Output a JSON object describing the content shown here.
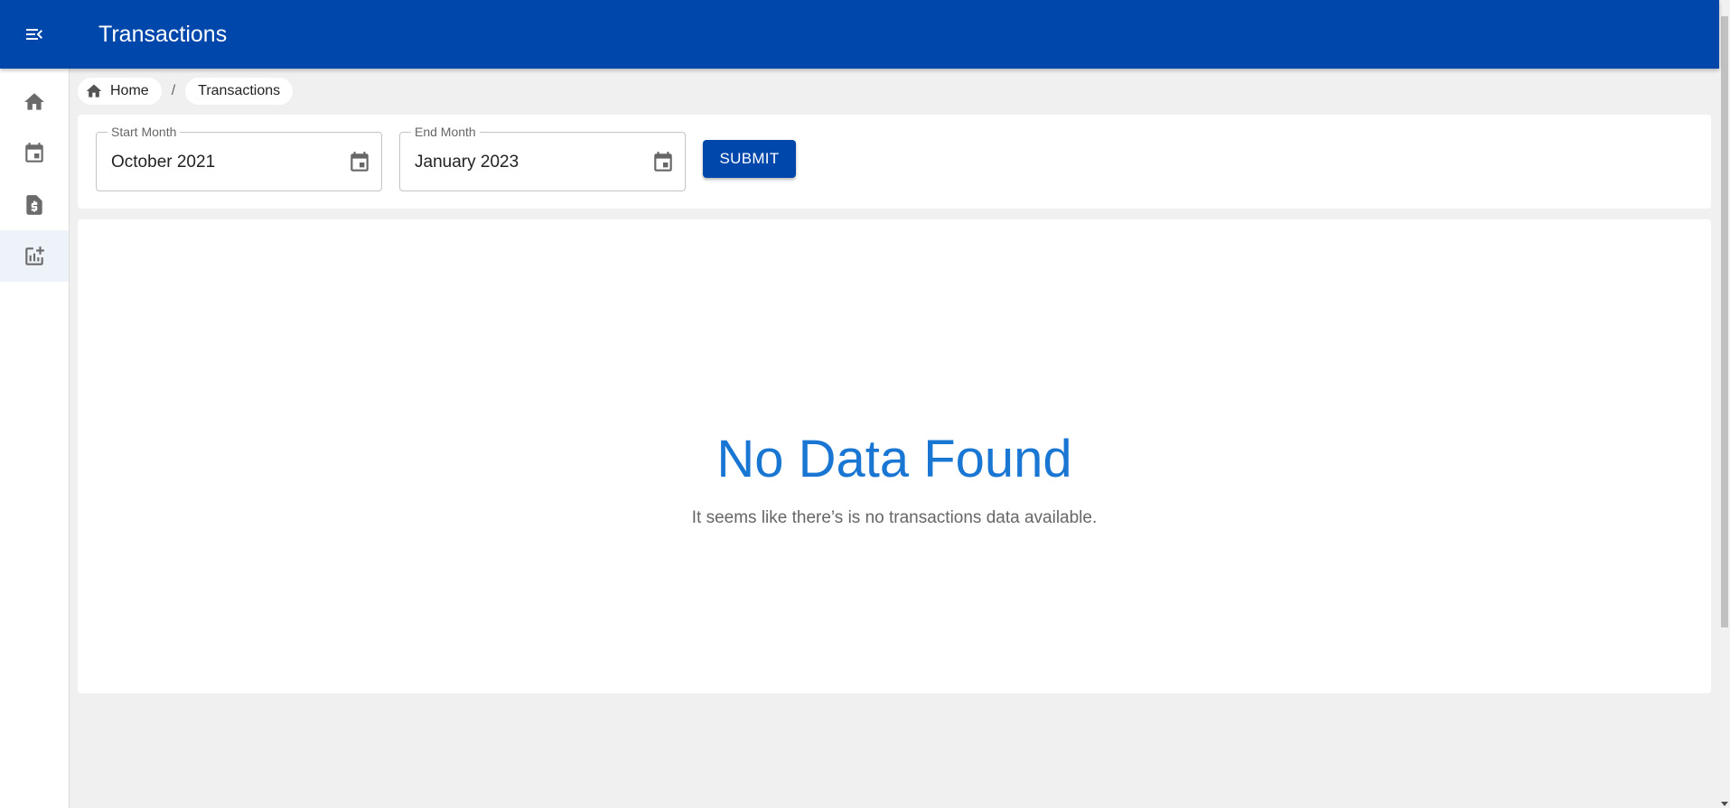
{
  "app": {
    "title": "Transactions"
  },
  "icons": {
    "menu": "menu-open-icon",
    "home": "home-icon",
    "calendar": "calendar-icon",
    "invoice": "invoice-dollar-icon",
    "report": "add-chart-icon"
  },
  "sidebar": {
    "items": [
      {
        "name": "home",
        "icon": "home-icon",
        "active": false
      },
      {
        "name": "calendar",
        "icon": "calendar-icon",
        "active": false
      },
      {
        "name": "invoice",
        "icon": "invoice-dollar-icon",
        "active": false
      },
      {
        "name": "transactions",
        "icon": "add-chart-icon",
        "active": true
      }
    ]
  },
  "breadcrumb": {
    "home_label": "Home",
    "separator": "/",
    "current_label": "Transactions"
  },
  "filters": {
    "start": {
      "label": "Start Month",
      "value": "October 2021"
    },
    "end": {
      "label": "End Month",
      "value": "January 2023"
    },
    "submit_label": "SUBMIT"
  },
  "empty_state": {
    "title": "No Data Found",
    "message": "It seems like there’s is no transactions data available."
  },
  "colors": {
    "primary": "#0047ab",
    "accent_text": "#1976d2",
    "background": "#f0f0f0"
  }
}
